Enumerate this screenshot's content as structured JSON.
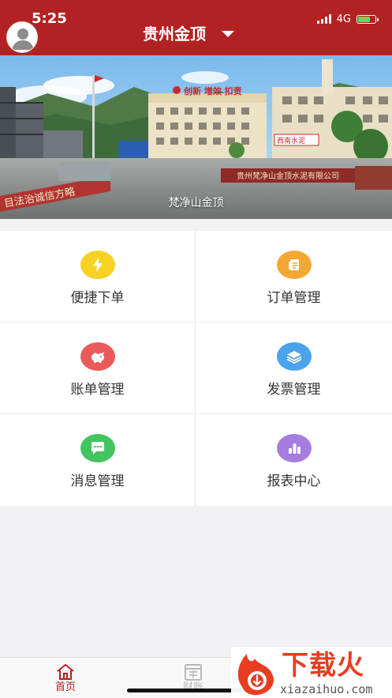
{
  "status_bar": {
    "time": "5:25",
    "network": "4G",
    "battery_level": 0.72,
    "battery_color": "#57e056"
  },
  "header": {
    "title": "贵州金顶",
    "background_color": "#b32222",
    "avatar_icon": "person-icon",
    "dropdown_icon": "chevron-down-icon"
  },
  "banner": {
    "caption": "梵净山金顶",
    "signs": {
      "slogan": "创新  增效  扣责",
      "building_plate": "西南水泥",
      "company_plate": "贵州梵净山金顶水泥有限公司",
      "wall_slogan": "目法治诚信方略"
    }
  },
  "menu": {
    "items": [
      {
        "label": "便捷下单",
        "icon": "lightning-icon",
        "color": "#f7d225"
      },
      {
        "label": "订单管理",
        "icon": "document-icon",
        "color": "#f4a834"
      },
      {
        "label": "账单管理",
        "icon": "piggy-bank-icon",
        "color": "#ea5a5a"
      },
      {
        "label": "发票管理",
        "icon": "layers-icon",
        "color": "#4aa3ec"
      },
      {
        "label": "消息管理",
        "icon": "chat-bubble-icon",
        "color": "#42c460"
      },
      {
        "label": "报表中心",
        "icon": "bar-chart-icon",
        "color": "#a57ddf"
      }
    ]
  },
  "tabbar": {
    "items": [
      {
        "label": "首页",
        "icon": "home-icon",
        "active": true
      },
      {
        "label": "财账",
        "icon": "calendar-icon",
        "active": false
      }
    ]
  },
  "watermark": {
    "title": "下载火",
    "url": "xiazaihuo.com"
  }
}
